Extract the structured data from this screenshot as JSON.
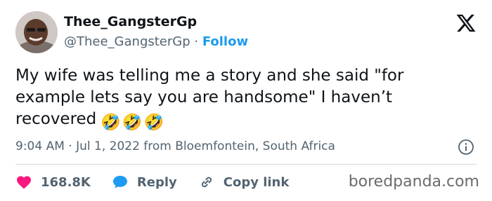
{
  "user": {
    "display_name": "Thee_GangsterGp",
    "handle": "@Thee_GangsterGp",
    "separator": " · ",
    "follow_label": "Follow"
  },
  "tweet": {
    "text": "My wife was telling me a story and she said \"for example lets say you are handsome\" I haven’t recovered",
    "emojis": [
      "🤣",
      "🤣",
      "🤣"
    ],
    "timestamp": "9:04 AM · Jul 1, 2022 from Bloemfontein, South Africa"
  },
  "actions": {
    "likes": "168.8K",
    "reply_label": "Reply",
    "copy_link_label": "Copy link"
  },
  "watermark": "boredpanda.com",
  "colors": {
    "accent": "#1d9bf0",
    "like": "#f91880",
    "text": "#0f1419",
    "muted": "#536471"
  },
  "icons": {
    "brand": "x-logo-icon",
    "info": "info-icon",
    "like": "heart-icon",
    "reply": "speech-bubble-icon",
    "copy": "link-icon"
  }
}
